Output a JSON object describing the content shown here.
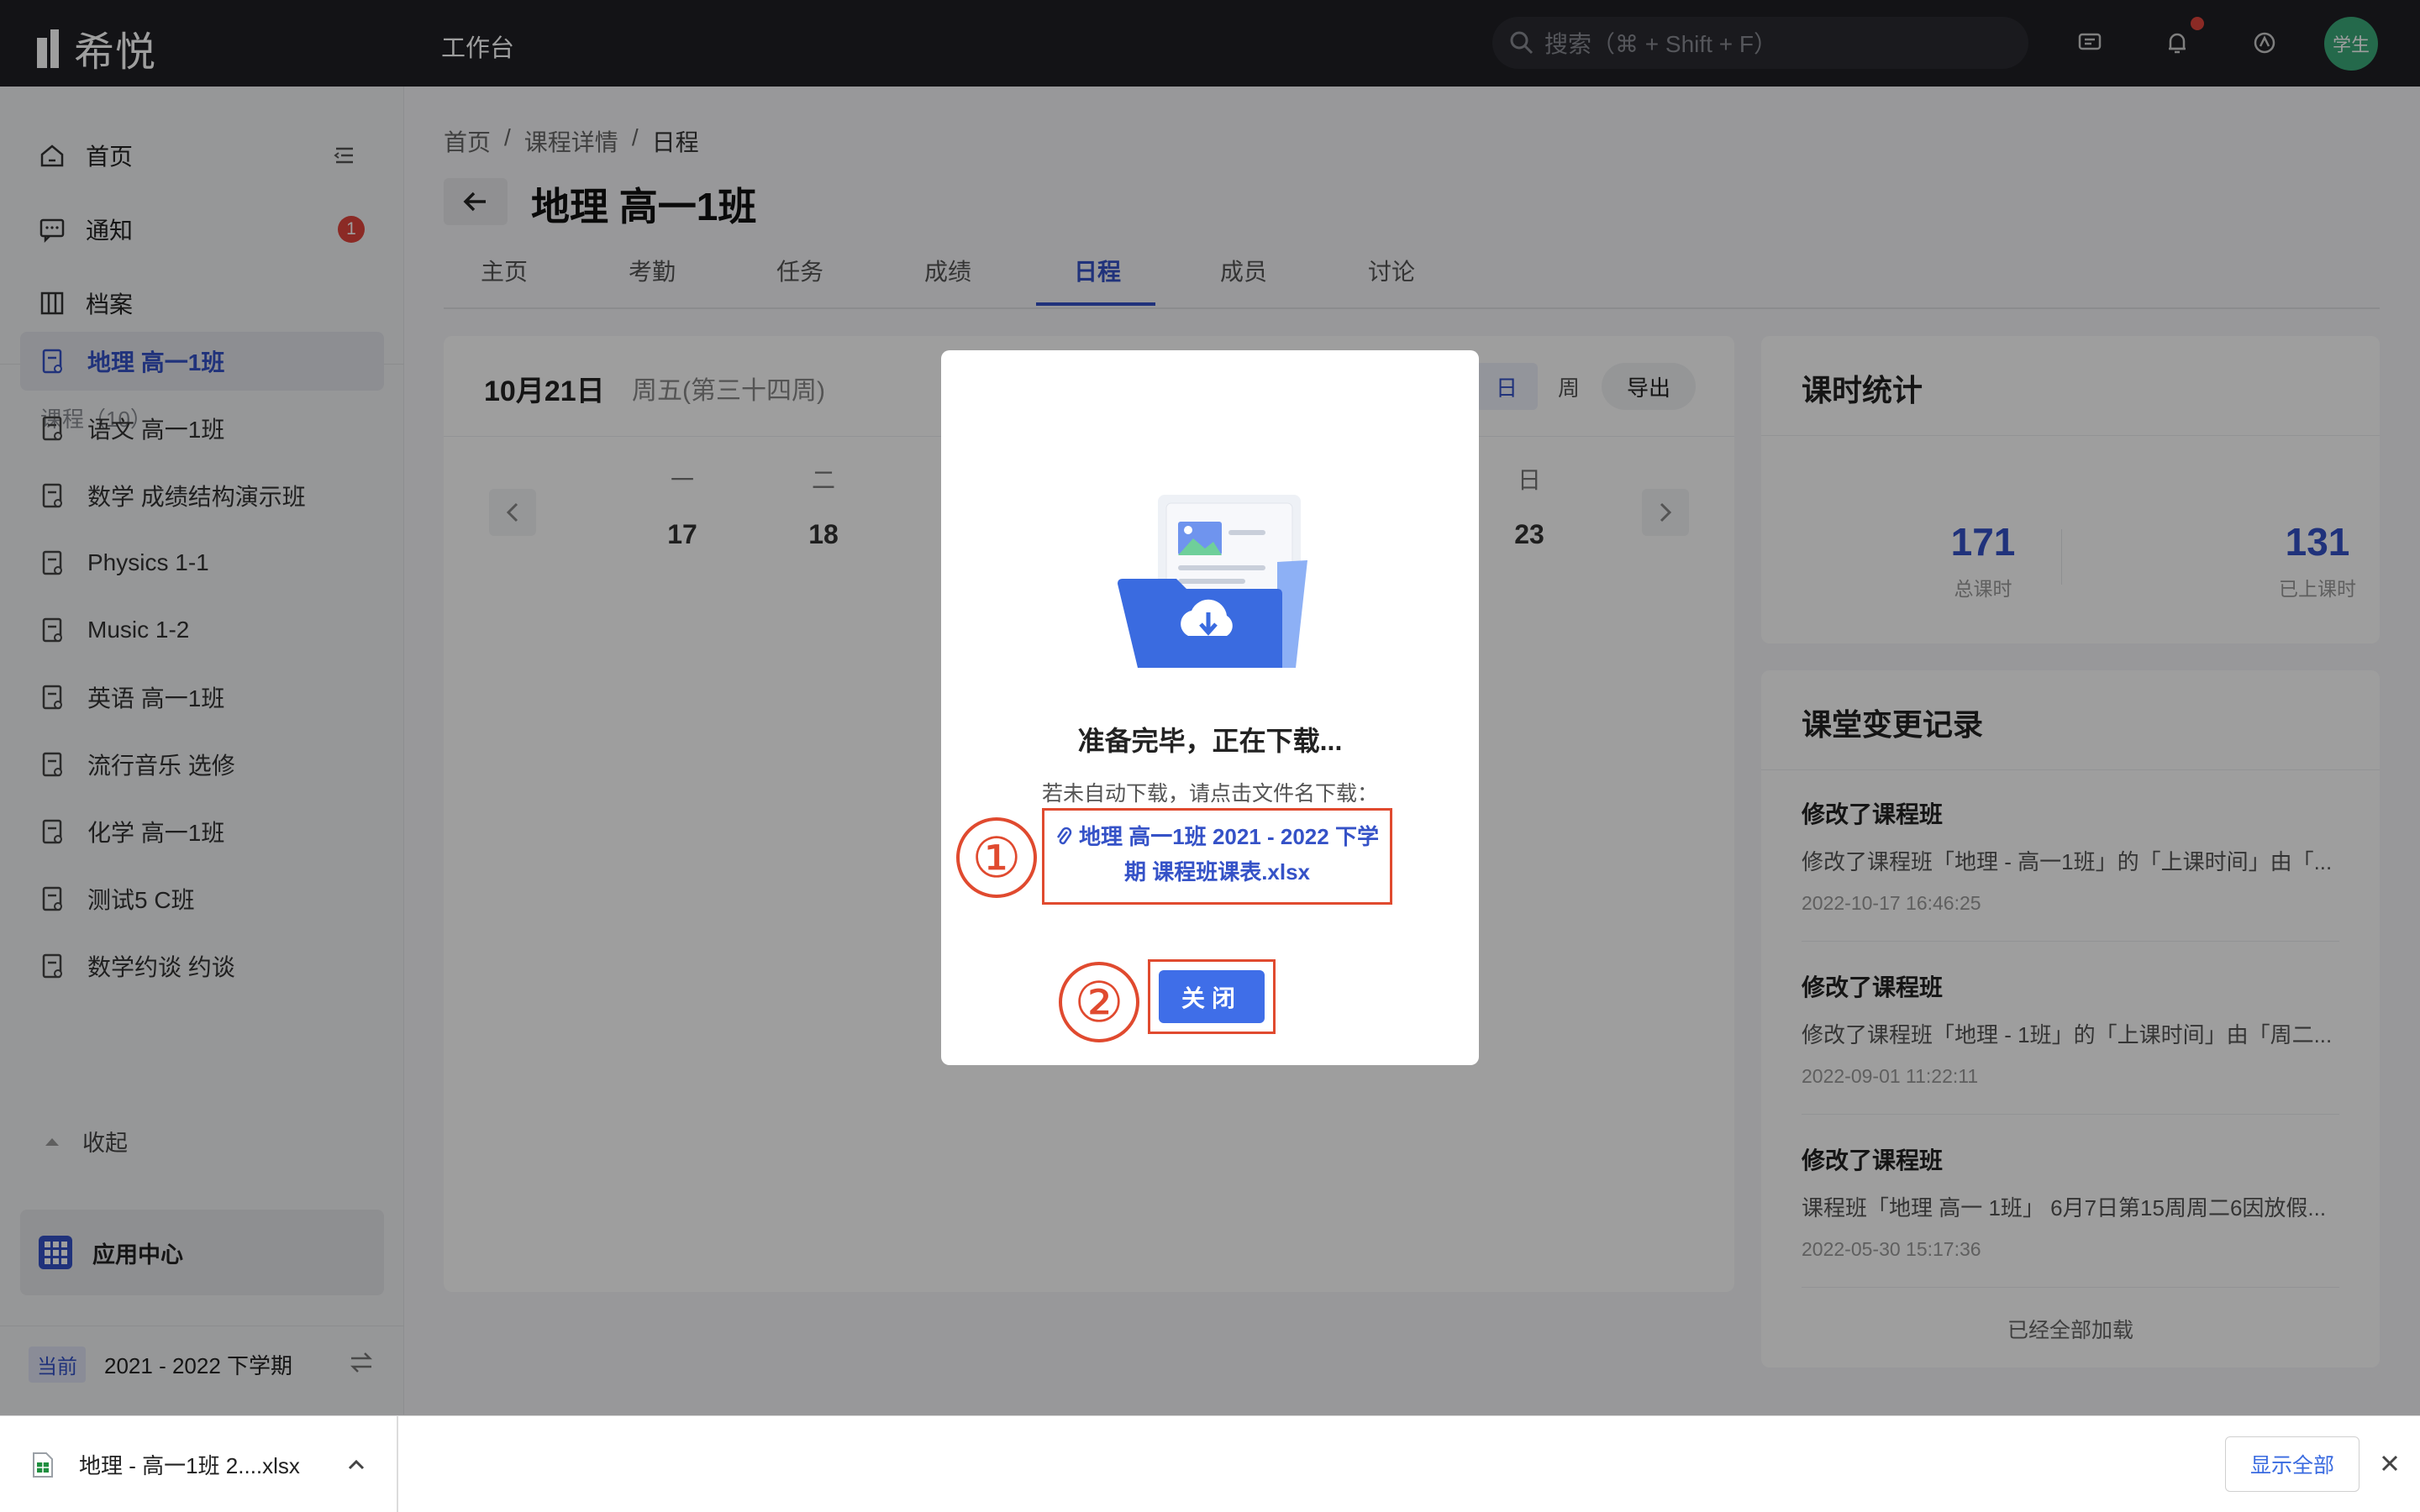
{
  "topbar": {
    "logo_text": "希悦",
    "workbench": "工作台",
    "search_placeholder": "搜索（⌘ + Shift + F）",
    "avatar_text": "学生"
  },
  "sidebar": {
    "nav": [
      {
        "label": "首页",
        "icon": "home-icon"
      },
      {
        "label": "通知",
        "icon": "message-icon",
        "badge": "1"
      },
      {
        "label": "档案",
        "icon": "archive-icon"
      }
    ],
    "courses_title": "课程（10）",
    "courses": [
      "地理 高一1班",
      "语文 高一1班",
      "数学 成绩结构演示班",
      "Physics 1-1",
      "Music 1-2",
      "英语 高一1班",
      "流行音乐 选修",
      "化学 高一1班",
      "测试5 C班",
      "数学约谈 约谈"
    ],
    "collapse_label": "收起",
    "app_center": "应用中心",
    "term_tag": "当前",
    "term": "2021 - 2022 下学期"
  },
  "breadcrumb": [
    "首页",
    "/",
    "课程详情",
    "/",
    "日程"
  ],
  "page_title": "地理 高一1班",
  "tabs": [
    "主页",
    "考勤",
    "任务",
    "成绩",
    "日程",
    "成员",
    "讨论"
  ],
  "active_tab": "日程",
  "calendar": {
    "date": "10月21日",
    "weekday": "周五(第三十四周)",
    "view_day": "日",
    "view_week": "周",
    "export": "导出",
    "weekdays": [
      "一",
      "二",
      "日"
    ],
    "days": [
      "17",
      "18",
      "23"
    ]
  },
  "stats": {
    "title": "课时统计",
    "total": "171",
    "total_label": "总课时",
    "done": "131",
    "done_label": "已上课时"
  },
  "changes": {
    "title": "课堂变更记录",
    "records": [
      {
        "title": "修改了课程班",
        "desc": "修改了课程班「地理 - 高一1班」的「上课时间」由「...",
        "time": "2022-10-17 16:46:25"
      },
      {
        "title": "修改了课程班",
        "desc": "修改了课程班「地理 - 1班」的「上课时间」由「周二...",
        "time": "2022-09-01 11:22:11"
      },
      {
        "title": "修改了课程班",
        "desc": "课程班「地理 高一 1班」 6月7日第15周周二6因放假...",
        "time": "2022-05-30 15:17:36"
      }
    ],
    "all_loaded": "已经全部加载"
  },
  "modal": {
    "title": "准备完毕，正在下载...",
    "hint": "若未自动下载，请点击文件名下载：",
    "file_line1": "地理 高一1班 2021 - 2022 下学",
    "file_line2": "期 课程班课表.xlsx",
    "close": "关闭",
    "annotation_1": "①",
    "annotation_2": "②"
  },
  "download_bar": {
    "file": "地理 - 高一1班 2....xlsx",
    "show_all": "显示全部"
  },
  "colors": {
    "accent": "#3552c7",
    "button": "#3f6ee8",
    "annotation": "#e04a2f",
    "topbar": "#1f2025",
    "badge": "#e0453c"
  }
}
